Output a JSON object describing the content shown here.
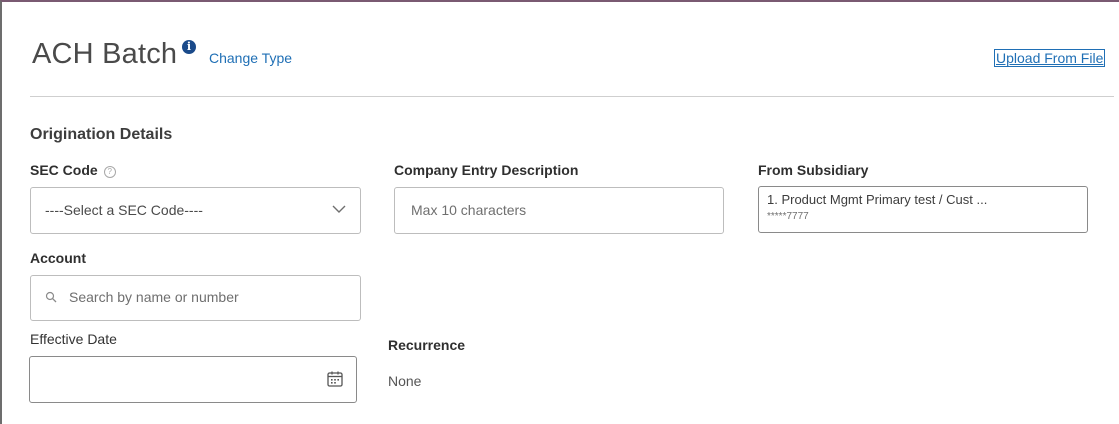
{
  "header": {
    "title": "ACH Batch",
    "info_icon": "info-icon",
    "change_type_label": "Change Type",
    "upload_label": "Upload From File"
  },
  "section": {
    "title": "Origination Details"
  },
  "fields": {
    "sec_code": {
      "label": "SEC Code",
      "help_icon": "question-circle-icon",
      "selected": "----Select a SEC Code----",
      "chevron_icon": "chevron-down-icon"
    },
    "company_entry_description": {
      "label": "Company Entry Description",
      "placeholder": "Max 10 characters"
    },
    "from_subsidiary": {
      "label": "From Subsidiary",
      "line1": "1. Product Mgmt Primary test / Cust ...",
      "line2": "*****7777"
    },
    "account": {
      "label": "Account",
      "placeholder": "Search by name or number",
      "search_icon": "search-icon"
    },
    "effective_date": {
      "label": "Effective Date",
      "value": "",
      "calendar_icon": "calendar-icon"
    },
    "recurrence": {
      "label": "Recurrence",
      "value": "None"
    }
  },
  "colors": {
    "link": "#1f6fb5",
    "info_icon": "#1a4a8a",
    "border": "#bdbdbd"
  }
}
